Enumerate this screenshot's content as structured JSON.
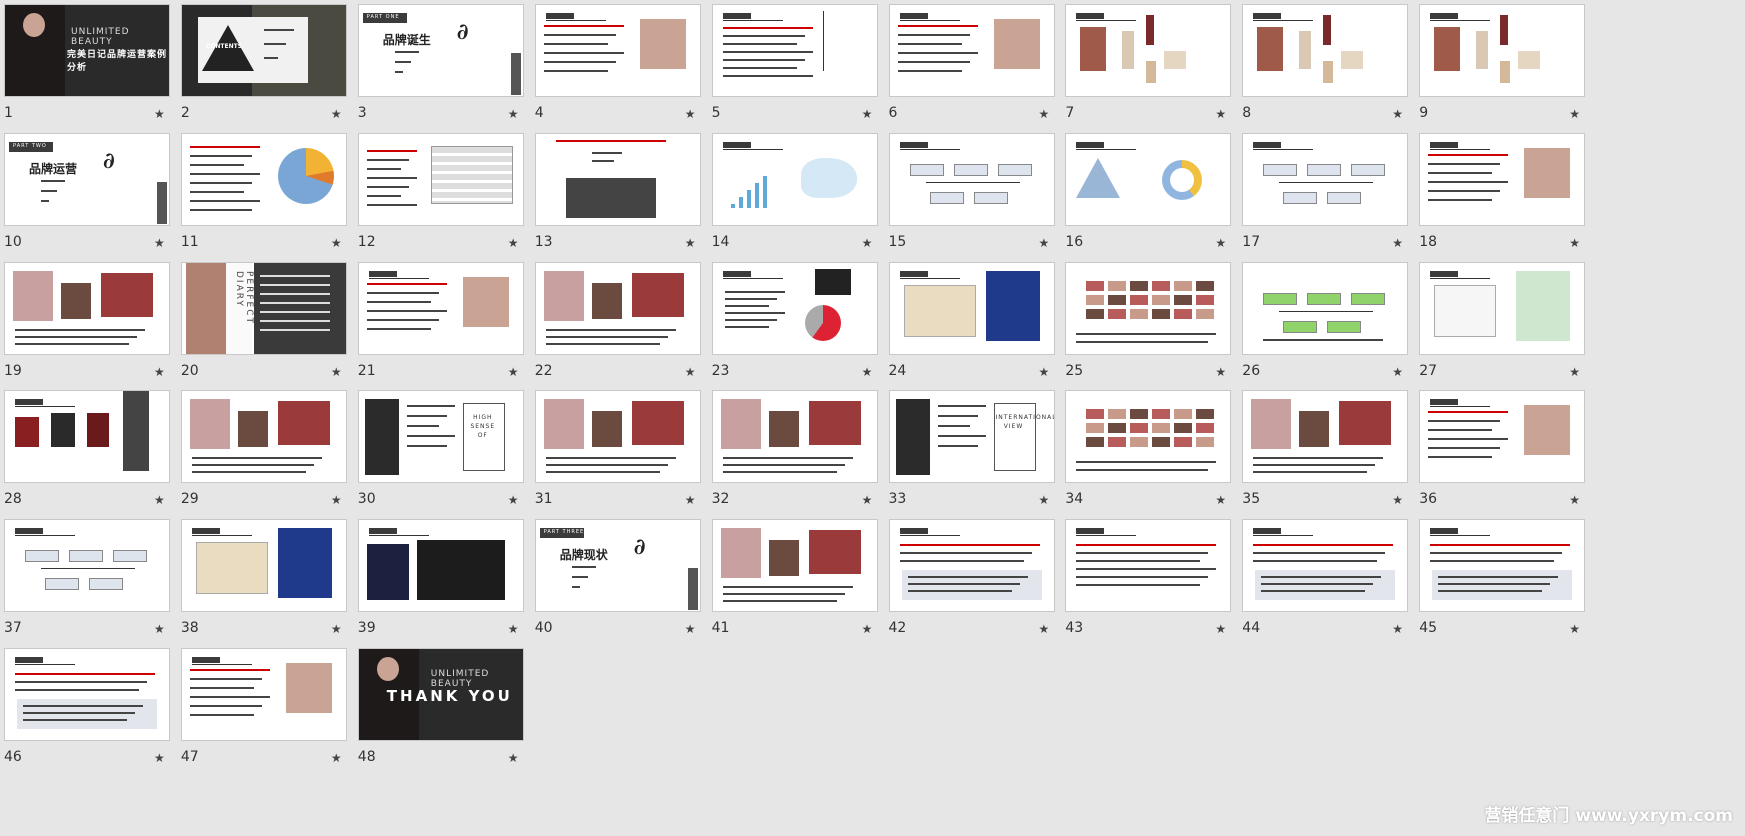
{
  "slides": [
    {
      "n": "1",
      "kind": "cover",
      "title": "UNLIMITED BEAUTY",
      "subtitle": "完美日记品牌运营案例分析"
    },
    {
      "n": "2",
      "kind": "contents",
      "label": "CONTENTS"
    },
    {
      "n": "3",
      "kind": "part",
      "title": "品牌诞生",
      "tag": "PART ONE"
    },
    {
      "n": "4",
      "kind": "text-photo"
    },
    {
      "n": "5",
      "kind": "text-vertical"
    },
    {
      "n": "6",
      "kind": "text-photo"
    },
    {
      "n": "7",
      "kind": "products"
    },
    {
      "n": "8",
      "kind": "products"
    },
    {
      "n": "9",
      "kind": "products"
    },
    {
      "n": "10",
      "kind": "part",
      "title": "品牌运营",
      "tag": "PART TWO"
    },
    {
      "n": "11",
      "kind": "pie"
    },
    {
      "n": "12",
      "kind": "table"
    },
    {
      "n": "13",
      "kind": "quad"
    },
    {
      "n": "14",
      "kind": "chart-map"
    },
    {
      "n": "15",
      "kind": "flow"
    },
    {
      "n": "16",
      "kind": "pyramid"
    },
    {
      "n": "17",
      "kind": "flow"
    },
    {
      "n": "18",
      "kind": "text-photo"
    },
    {
      "n": "19",
      "kind": "collage"
    },
    {
      "n": "20",
      "kind": "perfect",
      "label": "PERFECT DIARY"
    },
    {
      "n": "21",
      "kind": "text-photo"
    },
    {
      "n": "22",
      "kind": "collage"
    },
    {
      "n": "23",
      "kind": "donut"
    },
    {
      "n": "24",
      "kind": "bars"
    },
    {
      "n": "25",
      "kind": "grid-photos"
    },
    {
      "n": "26",
      "kind": "green-flow"
    },
    {
      "n": "27",
      "kind": "scatter"
    },
    {
      "n": "28",
      "kind": "three-photos"
    },
    {
      "n": "29",
      "kind": "collage"
    },
    {
      "n": "30",
      "kind": "high-sense",
      "label": "HIGH SENSE OF"
    },
    {
      "n": "31",
      "kind": "collage"
    },
    {
      "n": "32",
      "kind": "collage"
    },
    {
      "n": "33",
      "kind": "international",
      "label": "INTERNATIONAL VIEW"
    },
    {
      "n": "34",
      "kind": "grid-photos"
    },
    {
      "n": "35",
      "kind": "collage"
    },
    {
      "n": "36",
      "kind": "text-photo"
    },
    {
      "n": "37",
      "kind": "flow"
    },
    {
      "n": "38",
      "kind": "bars"
    },
    {
      "n": "39",
      "kind": "dark-chart"
    },
    {
      "n": "40",
      "kind": "part",
      "title": "品牌现状",
      "tag": "PART THREE"
    },
    {
      "n": "41",
      "kind": "collage"
    },
    {
      "n": "42",
      "kind": "text-box"
    },
    {
      "n": "43",
      "kind": "text"
    },
    {
      "n": "44",
      "kind": "text-box"
    },
    {
      "n": "45",
      "kind": "text-box"
    },
    {
      "n": "46",
      "kind": "text-box"
    },
    {
      "n": "47",
      "kind": "text-photo"
    },
    {
      "n": "48",
      "kind": "thanks",
      "title": "THANK YOU",
      "subtitle": "UNLIMITED BEAUTY"
    }
  ],
  "star_glyph": "★",
  "watermark": "营销任意门 www.yxrym.com"
}
